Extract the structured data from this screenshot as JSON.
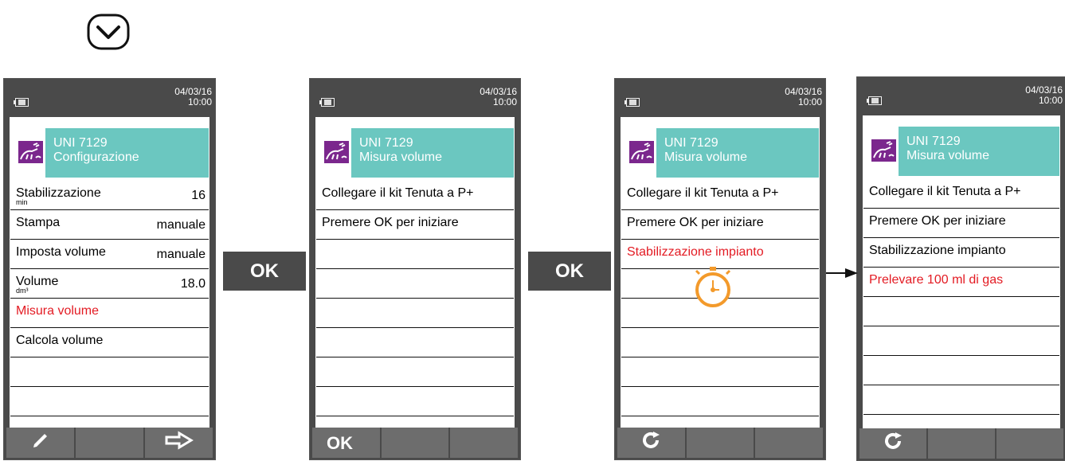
{
  "colors": {
    "header": "#6bc7c0",
    "accent_red": "#e31b23",
    "frame": "#4a4a4a"
  },
  "top_icon": "chevron-down-icon",
  "between_screens": {
    "ok1": "OK",
    "ok2": "OK",
    "arrow_icon": "arrow-right-icon"
  },
  "screens": [
    {
      "time": "04/03/16\n10:00",
      "title": "UNI 7129",
      "subtitle": "Configurazione",
      "rows": [
        {
          "label": "Stabilizzazione",
          "value": "16",
          "unit": "min"
        },
        {
          "label": "Stampa",
          "value": "manuale"
        },
        {
          "label": "Imposta volume",
          "value": "manuale"
        },
        {
          "label": "Volume",
          "value": "18.0",
          "unit": "dm³"
        },
        {
          "label": "Misura volume",
          "highlight": true
        },
        {
          "label": "Calcola volume"
        },
        {
          "label": ""
        },
        {
          "label": ""
        }
      ],
      "softkeys": [
        "pencil-icon",
        "",
        "arrow-right-icon"
      ]
    },
    {
      "time": "04/03/16\n10:00",
      "title": "UNI 7129",
      "subtitle": "Misura volume",
      "rows": [
        {
          "label": "Collegare il kit Tenuta a P+"
        },
        {
          "label": "Premere OK per iniziare"
        },
        {
          "label": ""
        },
        {
          "label": ""
        },
        {
          "label": ""
        },
        {
          "label": ""
        },
        {
          "label": ""
        },
        {
          "label": ""
        }
      ],
      "softkeys": [
        "OK",
        "",
        ""
      ]
    },
    {
      "time": "04/03/16\n10:00",
      "title": "UNI 7129",
      "subtitle": "Misura volume",
      "rows": [
        {
          "label": "Collegare il kit Tenuta a P+"
        },
        {
          "label": "Premere OK per iniziare"
        },
        {
          "label": "Stabilizzazione impianto",
          "highlight": true
        },
        {
          "label": ""
        },
        {
          "label": ""
        },
        {
          "label": ""
        },
        {
          "label": ""
        },
        {
          "label": ""
        }
      ],
      "softkeys": [
        "refresh-icon",
        "",
        ""
      ]
    },
    {
      "time": "04/03/16\n10:00",
      "title": "UNI 7129",
      "subtitle": "Misura volume",
      "rows": [
        {
          "label": "Collegare il kit Tenuta a P+"
        },
        {
          "label": "Premere OK per iniziare"
        },
        {
          "label": "Stabilizzazione impianto"
        },
        {
          "label": "Prelevare 100 ml di gas",
          "highlight": true
        },
        {
          "label": ""
        },
        {
          "label": ""
        },
        {
          "label": ""
        },
        {
          "label": ""
        }
      ],
      "softkeys": [
        "refresh-icon",
        "",
        ""
      ]
    }
  ]
}
